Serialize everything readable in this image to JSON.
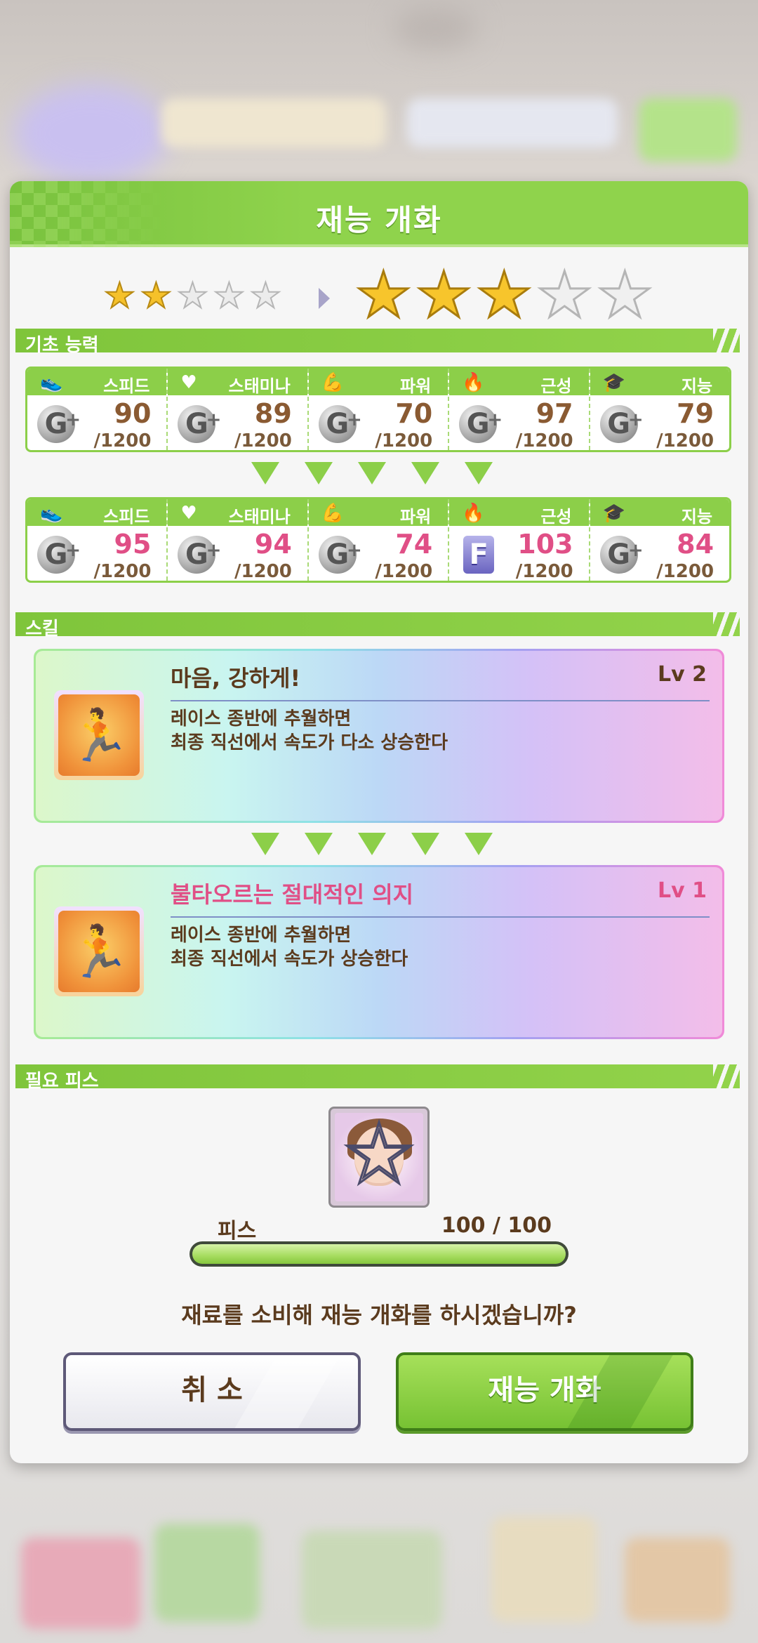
{
  "dialog": {
    "title": "재능 개화"
  },
  "stars": {
    "before": 2,
    "after": 3,
    "total": 5
  },
  "sections": {
    "basic": "기초 능력",
    "skill": "스킬",
    "piece": "필요 피스"
  },
  "stats_before": [
    {
      "label": "스피드",
      "icon": "shoe-icon",
      "grade": "G",
      "value": "90",
      "max": "/1200"
    },
    {
      "label": "스태미나",
      "icon": "heart-icon",
      "grade": "G",
      "value": "89",
      "max": "/1200"
    },
    {
      "label": "파워",
      "icon": "muscle-icon",
      "grade": "G",
      "value": "70",
      "max": "/1200"
    },
    {
      "label": "근성",
      "icon": "flame-icon",
      "grade": "G",
      "value": "97",
      "max": "/1200"
    },
    {
      "label": "지능",
      "icon": "graduation-cap-icon",
      "grade": "G",
      "value": "79",
      "max": "/1200"
    }
  ],
  "stats_after": [
    {
      "label": "스피드",
      "icon": "shoe-icon",
      "grade": "G",
      "value": "95",
      "max": "/1200"
    },
    {
      "label": "스태미나",
      "icon": "heart-icon",
      "grade": "G",
      "value": "94",
      "max": "/1200"
    },
    {
      "label": "파워",
      "icon": "muscle-icon",
      "grade": "G",
      "value": "74",
      "max": "/1200"
    },
    {
      "label": "근성",
      "icon": "flame-icon",
      "grade": "F",
      "value": "103",
      "max": "/1200"
    },
    {
      "label": "지능",
      "icon": "graduation-cap-icon",
      "grade": "G",
      "value": "84",
      "max": "/1200"
    }
  ],
  "skill_before": {
    "name": "마음, 강하게!",
    "level": "Lv 2",
    "desc1": "레이스 종반에 추월하면",
    "desc2": "최종 직선에서 속도가 다소 상승한다"
  },
  "skill_after": {
    "name": "불타오르는 절대적인 의지",
    "level": "Lv 1",
    "desc1": "레이스 종반에 추월하면",
    "desc2": "최종 직선에서 속도가 상승한다"
  },
  "piece": {
    "label": "피스",
    "count": "100 / 100",
    "progress": 1.0
  },
  "confirm_text": "재료를 소비해 재능 개화를 하시겠습니까?",
  "buttons": {
    "cancel": "취 소",
    "ok": "재능 개화"
  },
  "colors": {
    "accent_green": "#8ccf49",
    "stat_up_pink": "#e04f86",
    "text_brown": "#5b3b1e"
  }
}
